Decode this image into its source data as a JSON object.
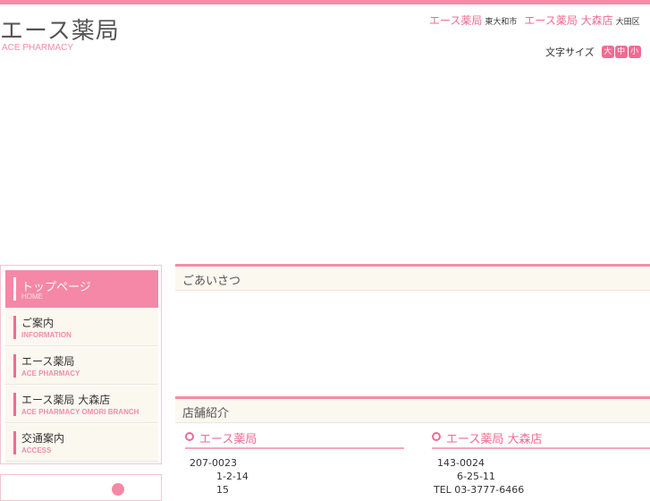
{
  "header": {
    "logo_title": "エース薬局",
    "logo_sub": "ACE PHARMACY",
    "stores": [
      {
        "name": "エース薬局",
        "city": "東大和市"
      },
      {
        "name": "エース薬局 大森店",
        "city": "大田区"
      }
    ],
    "font_size": {
      "label": "文字サイズ",
      "options": [
        "大",
        "中",
        "小"
      ]
    }
  },
  "nav": {
    "items": [
      {
        "jp": "トップページ",
        "en": "HOME",
        "active": true
      },
      {
        "jp": "ご案内",
        "en": "INFORMATION"
      },
      {
        "jp": "エース薬局",
        "en": "ACE PHARMACY"
      },
      {
        "jp": "エース薬局 大森店",
        "en": "ACE PHARMACY OMORI BRANCH"
      },
      {
        "jp": "交通案内",
        "en": "ACCESS"
      }
    ]
  },
  "main": {
    "greeting_title": "ごあいさつ",
    "stores_title": "店舗紹介",
    "stores": [
      {
        "name": "エース薬局",
        "postal": "207-0023",
        "addr1": "1-2-14",
        "addr2": "15"
      },
      {
        "name": "エース薬局 大森店",
        "postal": "143-0024",
        "addr1": "6-25-11",
        "addr2": "TEL 03-3777-6466"
      }
    ]
  },
  "colors": {
    "accent": "#f06b92",
    "accent_light": "#f58ca8",
    "panel_bg": "#fbf8f0"
  }
}
